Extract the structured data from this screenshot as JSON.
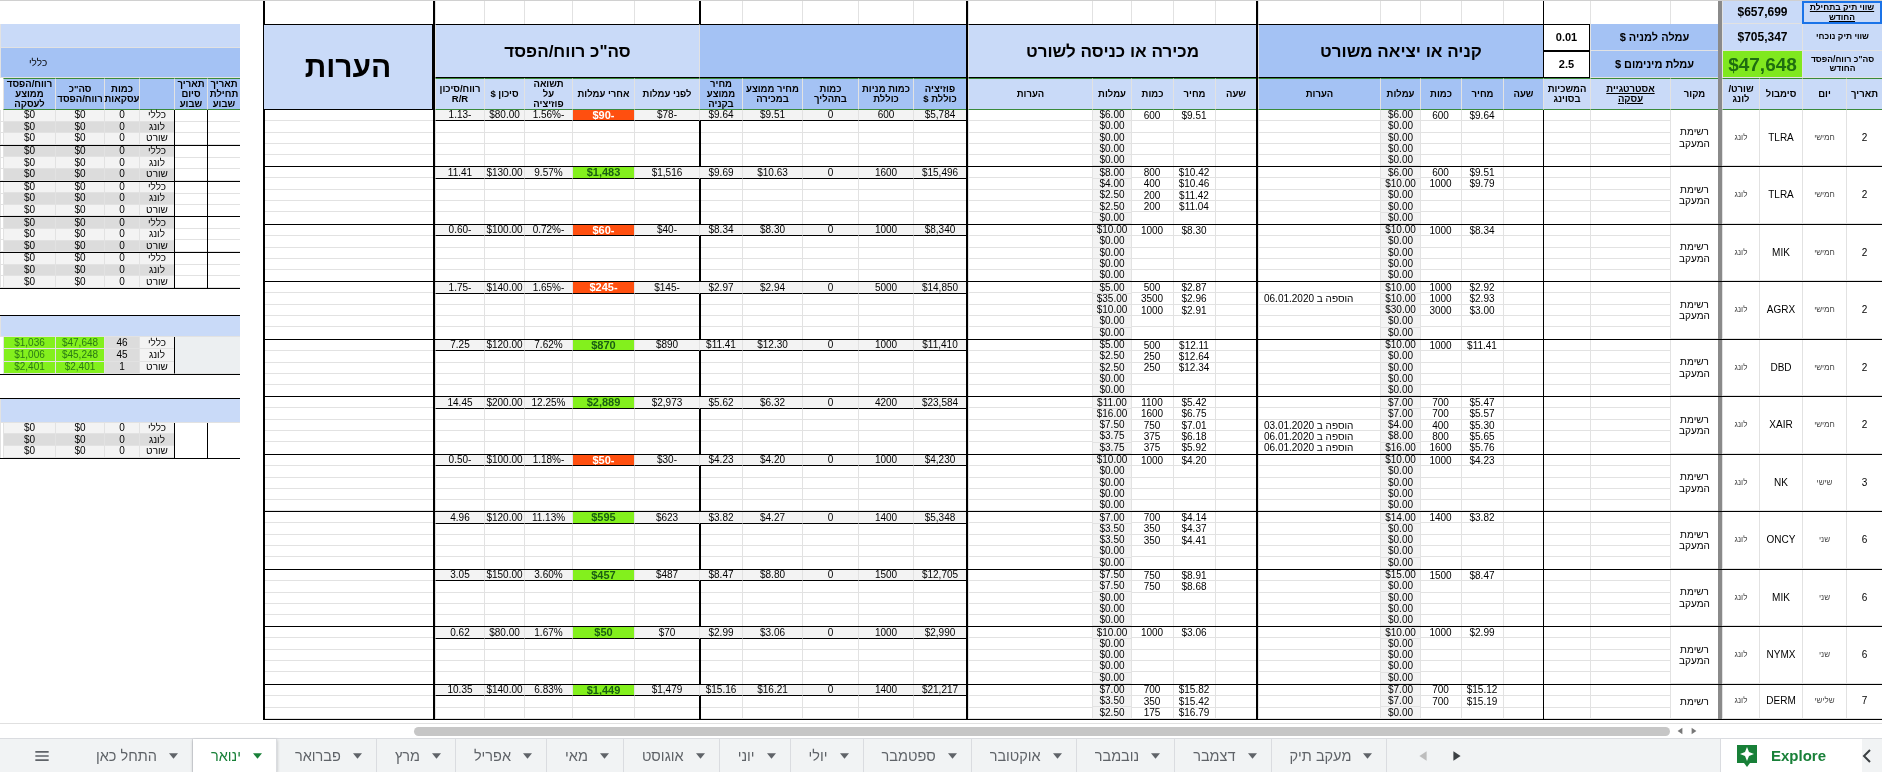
{
  "portfolio": [
    {
      "label": "שווי תיק בתחילת החודש",
      "value": "$657,699",
      "kind": "plain",
      "selected": true
    },
    {
      "label": "שווי תיק נוכחי",
      "value": "$705,347",
      "kind": "plain",
      "selected": false
    },
    {
      "label": "סה\"כ רווח/הפסד החודש",
      "value": "$47,648",
      "kind": "highlight",
      "selected": false
    }
  ],
  "fees": [
    {
      "label": "עמלה למניה $",
      "value": "0.01"
    },
    {
      "label": "עמלת מינימום $",
      "value": "2.5"
    }
  ],
  "sections": {
    "buy_title": "קניה או יציאה משורט",
    "sell_title": "מכירה או כניסה לשורט",
    "pl_title": "סה\"כ רווח/הפסד",
    "notes_title": "הערות"
  },
  "columns": {
    "frozen": [
      "תאריך",
      "יום",
      "סימבול",
      "שורט/ לונג"
    ],
    "pre": [
      "מקור",
      "אסטרטגיית עסקה",
      "המשכיות בסוינג"
    ],
    "buy": [
      "שעה",
      "מחיר",
      "כמות",
      "עמלות",
      "הערות"
    ],
    "sell": [
      "שעה",
      "מחיר",
      "כמות",
      "עמלות",
      "הערות"
    ],
    "position": [
      "פוזיציה כוללת $",
      "כמות מניות כוללת",
      "כמות בתהליך",
      "מחיר ממוצע במכירה",
      "מחיר ממוצע בקניה"
    ],
    "pl": [
      "לפני עמלות",
      "אחרי עמלות",
      "תשואה על פוזיציה",
      "סיכון $",
      "רווח/סיכון R/R"
    ]
  },
  "trades": [
    {
      "date": "2",
      "day": "חמישי",
      "symbol": "TLRA",
      "side": "לונג",
      "source": "רשימת המעקב",
      "buys": [
        {
          "fee": "$6.00",
          "qty": "600",
          "price": "$9.64"
        },
        {
          "fee": "$0.00"
        },
        {
          "fee": "$0.00"
        },
        {
          "fee": "$0.00"
        },
        {
          "fee": "$0.00"
        }
      ],
      "sells": [
        {
          "fee": "$6.00",
          "qty": "600",
          "price": "$9.51"
        },
        {
          "fee": "$0.00"
        },
        {
          "fee": "$0.00"
        },
        {
          "fee": "$0.00"
        },
        {
          "fee": "$0.00"
        }
      ],
      "position": {
        "total": "$5,784",
        "shares": "600",
        "in_progress": "0",
        "avg_sell": "$9.51",
        "avg_buy": "$9.64"
      },
      "pl": {
        "before": "$78-",
        "after": "$90-",
        "color": "#ff4f0f",
        "return": "1.56%-",
        "risk": "$80.00",
        "rr": "1.13-"
      }
    },
    {
      "date": "2",
      "day": "חמישי",
      "symbol": "TLRA",
      "side": "לונג",
      "source": "רשימת המעקב",
      "buys": [
        {
          "fee": "$6.00",
          "qty": "600",
          "price": "$9.51"
        },
        {
          "fee": "$10.00",
          "qty": "1000",
          "price": "$9.79"
        },
        {
          "fee": "$0.00"
        },
        {
          "fee": "$0.00"
        },
        {
          "fee": "$0.00"
        }
      ],
      "sells": [
        {
          "fee": "$8.00",
          "qty": "800",
          "price": "$10.42"
        },
        {
          "fee": "$4.00",
          "qty": "400",
          "price": "$10.46"
        },
        {
          "fee": "$2.50",
          "qty": "200",
          "price": "$11.42"
        },
        {
          "fee": "$2.50",
          "qty": "200",
          "price": "$11.04"
        },
        {
          "fee": "$0.00"
        }
      ],
      "position": {
        "total": "$15,496",
        "shares": "1600",
        "in_progress": "0",
        "avg_sell": "$10.63",
        "avg_buy": "$9.69"
      },
      "pl": {
        "before": "$1,516",
        "after": "$1,483",
        "color": "#83f01d",
        "return": "9.57%",
        "risk": "$130.00",
        "rr": "11.41"
      }
    },
    {
      "date": "2",
      "day": "חמישי",
      "symbol": "MIK",
      "side": "לונג",
      "source": "רשימת המעקב",
      "buys": [
        {
          "fee": "$10.00",
          "qty": "1000",
          "price": "$8.34"
        },
        {
          "fee": "$0.00"
        },
        {
          "fee": "$0.00"
        },
        {
          "fee": "$0.00"
        },
        {
          "fee": "$0.00"
        }
      ],
      "sells": [
        {
          "fee": "$10.00",
          "qty": "1000",
          "price": "$8.30"
        },
        {
          "fee": "$0.00"
        },
        {
          "fee": "$0.00"
        },
        {
          "fee": "$0.00"
        },
        {
          "fee": "$0.00"
        }
      ],
      "position": {
        "total": "$8,340",
        "shares": "1000",
        "in_progress": "0",
        "avg_sell": "$8.30",
        "avg_buy": "$8.34"
      },
      "pl": {
        "before": "$40-",
        "after": "$60-",
        "color": "#ff4f0f",
        "return": "0.72%-",
        "risk": "$100.00",
        "rr": "0.60-"
      }
    },
    {
      "date": "2",
      "day": "חמישי",
      "symbol": "AGRX",
      "side": "לונג",
      "source": "רשימת המעקב",
      "buys": [
        {
          "fee": "$10.00",
          "qty": "1000",
          "price": "$2.92"
        },
        {
          "fee": "$10.00",
          "qty": "1000",
          "price": "$2.93",
          "note": "הוספה ב 06.01.2020"
        },
        {
          "fee": "$30.00",
          "qty": "3000",
          "price": "$3.00"
        },
        {
          "fee": "$0.00"
        },
        {
          "fee": "$0.00"
        }
      ],
      "sells": [
        {
          "fee": "$5.00",
          "qty": "500",
          "price": "$2.87"
        },
        {
          "fee": "$35.00",
          "qty": "3500",
          "price": "$2.96"
        },
        {
          "fee": "$10.00",
          "qty": "1000",
          "price": "$2.91"
        },
        {
          "fee": "$0.00"
        },
        {
          "fee": "$0.00"
        }
      ],
      "position": {
        "total": "$14,850",
        "shares": "5000",
        "in_progress": "0",
        "avg_sell": "$2.94",
        "avg_buy": "$2.97"
      },
      "pl": {
        "before": "$145-",
        "after": "$245-",
        "color": "#ff4f0f",
        "return": "1.65%-",
        "risk": "$140.00",
        "rr": "1.75-"
      }
    },
    {
      "date": "2",
      "day": "חמישי",
      "symbol": "DBD",
      "side": "לונג",
      "source": "רשימת המעקב",
      "buys": [
        {
          "fee": "$10.00",
          "qty": "1000",
          "price": "$11.41"
        },
        {
          "fee": "$0.00"
        },
        {
          "fee": "$0.00"
        },
        {
          "fee": "$0.00"
        },
        {
          "fee": "$0.00"
        }
      ],
      "sells": [
        {
          "fee": "$5.00",
          "qty": "500",
          "price": "$12.11"
        },
        {
          "fee": "$2.50",
          "qty": "250",
          "price": "$12.64"
        },
        {
          "fee": "$2.50",
          "qty": "250",
          "price": "$12.34"
        },
        {
          "fee": "$0.00"
        },
        {
          "fee": "$0.00"
        }
      ],
      "position": {
        "total": "$11,410",
        "shares": "1000",
        "in_progress": "0",
        "avg_sell": "$12.30",
        "avg_buy": "$11.41"
      },
      "pl": {
        "before": "$890",
        "after": "$870",
        "color": "#83f01d",
        "return": "7.62%",
        "risk": "$120.00",
        "rr": "7.25"
      }
    },
    {
      "date": "2",
      "day": "חמישי",
      "symbol": "XAIR",
      "side": "לונג",
      "source": "רשימת המעקב",
      "buys": [
        {
          "fee": "$7.00",
          "qty": "700",
          "price": "$5.47"
        },
        {
          "fee": "$7.00",
          "qty": "700",
          "price": "$5.57"
        },
        {
          "fee": "$4.00",
          "qty": "400",
          "price": "$5.30",
          "note": "הוספה ב 03.01.2020"
        },
        {
          "fee": "$8.00",
          "qty": "800",
          "price": "$5.65",
          "note": "הוספה ב 06.01.2020"
        },
        {
          "fee": "$16.00",
          "qty": "1600",
          "price": "$5.76",
          "note": "הוספה ב 06.01.2020"
        }
      ],
      "sells": [
        {
          "fee": "$11.00",
          "qty": "1100",
          "price": "$5.42"
        },
        {
          "fee": "$16.00",
          "qty": "1600",
          "price": "$6.75"
        },
        {
          "fee": "$7.50",
          "qty": "750",
          "price": "$7.01"
        },
        {
          "fee": "$3.75",
          "qty": "375",
          "price": "$6.18"
        },
        {
          "fee": "$3.75",
          "qty": "375",
          "price": "$5.92"
        }
      ],
      "position": {
        "total": "$23,584",
        "shares": "4200",
        "in_progress": "0",
        "avg_sell": "$6.32",
        "avg_buy": "$5.62"
      },
      "pl": {
        "before": "$2,973",
        "after": "$2,889",
        "color": "#83f01d",
        "return": "12.25%",
        "risk": "$200.00",
        "rr": "14.45"
      }
    },
    {
      "date": "3",
      "day": "שישי",
      "symbol": "NK",
      "side": "לונג",
      "source": "רשימת המעקב",
      "buys": [
        {
          "fee": "$10.00",
          "qty": "1000",
          "price": "$4.23"
        },
        {
          "fee": "$0.00"
        },
        {
          "fee": "$0.00"
        },
        {
          "fee": "$0.00"
        },
        {
          "fee": "$0.00"
        }
      ],
      "sells": [
        {
          "fee": "$10.00",
          "qty": "1000",
          "price": "$4.20"
        },
        {
          "fee": "$0.00"
        },
        {
          "fee": "$0.00"
        },
        {
          "fee": "$0.00"
        },
        {
          "fee": "$0.00"
        }
      ],
      "position": {
        "total": "$4,230",
        "shares": "1000",
        "in_progress": "0",
        "avg_sell": "$4.20",
        "avg_buy": "$4.23"
      },
      "pl": {
        "before": "$30-",
        "after": "$50-",
        "color": "#ff4f0f",
        "return": "1.18%-",
        "risk": "$100.00",
        "rr": "0.50-"
      }
    },
    {
      "date": "6",
      "day": "שני",
      "symbol": "ONCY",
      "side": "לונג",
      "source": "רשימת המעקב",
      "buys": [
        {
          "fee": "$14.00",
          "qty": "1400",
          "price": "$3.82"
        },
        {
          "fee": "$0.00"
        },
        {
          "fee": "$0.00"
        },
        {
          "fee": "$0.00"
        },
        {
          "fee": "$0.00"
        }
      ],
      "sells": [
        {
          "fee": "$7.00",
          "qty": "700",
          "price": "$4.14"
        },
        {
          "fee": "$3.50",
          "qty": "350",
          "price": "$4.37"
        },
        {
          "fee": "$3.50",
          "qty": "350",
          "price": "$4.41"
        },
        {
          "fee": "$0.00"
        },
        {
          "fee": "$0.00"
        }
      ],
      "position": {
        "total": "$5,348",
        "shares": "1400",
        "in_progress": "0",
        "avg_sell": "$4.27",
        "avg_buy": "$3.82"
      },
      "pl": {
        "before": "$623",
        "after": "$595",
        "color": "#83f01d",
        "return": "11.13%",
        "risk": "$120.00",
        "rr": "4.96"
      }
    },
    {
      "date": "6",
      "day": "שני",
      "symbol": "MIK",
      "side": "לונג",
      "source": "רשימת המעקב",
      "buys": [
        {
          "fee": "$15.00",
          "qty": "1500",
          "price": "$8.47"
        },
        {
          "fee": "$0.00"
        },
        {
          "fee": "$0.00"
        },
        {
          "fee": "$0.00"
        },
        {
          "fee": "$0.00"
        }
      ],
      "sells": [
        {
          "fee": "$7.50",
          "qty": "750",
          "price": "$8.91"
        },
        {
          "fee": "$7.50",
          "qty": "750",
          "price": "$8.68"
        },
        {
          "fee": "$0.00"
        },
        {
          "fee": "$0.00"
        },
        {
          "fee": "$0.00"
        }
      ],
      "position": {
        "total": "$12,705",
        "shares": "1500",
        "in_progress": "0",
        "avg_sell": "$8.80",
        "avg_buy": "$8.47"
      },
      "pl": {
        "before": "$487",
        "after": "$457",
        "color": "#83f01d",
        "return": "3.60%",
        "risk": "$150.00",
        "rr": "3.05"
      }
    },
    {
      "date": "6",
      "day": "שני",
      "symbol": "NYMX",
      "side": "לונג",
      "source": "רשימת המעקב",
      "buys": [
        {
          "fee": "$10.00",
          "qty": "1000",
          "price": "$2.99"
        },
        {
          "fee": "$0.00"
        },
        {
          "fee": "$0.00"
        },
        {
          "fee": "$0.00"
        },
        {
          "fee": "$0.00"
        }
      ],
      "sells": [
        {
          "fee": "$10.00",
          "qty": "1000",
          "price": "$3.06"
        },
        {
          "fee": "$0.00"
        },
        {
          "fee": "$0.00"
        },
        {
          "fee": "$0.00"
        },
        {
          "fee": "$0.00"
        }
      ],
      "position": {
        "total": "$2,990",
        "shares": "1000",
        "in_progress": "0",
        "avg_sell": "$3.06",
        "avg_buy": "$2.99"
      },
      "pl": {
        "before": "$70",
        "after": "$50",
        "color": "#83f01d",
        "return": "1.67%",
        "risk": "$80.00",
        "rr": "0.62"
      }
    },
    {
      "date": "7",
      "day": "שלישי",
      "symbol": "DERM",
      "side": "לונג",
      "source": "רשימת",
      "buys": [
        {
          "fee": "$7.00",
          "qty": "700",
          "price": "$15.12"
        },
        {
          "fee": "$7.00",
          "qty": "700",
          "price": "$15.19"
        },
        {
          "fee": "$0.00"
        }
      ],
      "sells": [
        {
          "fee": "$7.00",
          "qty": "700",
          "price": "$15.82"
        },
        {
          "fee": "$3.50",
          "qty": "350",
          "price": "$15.42"
        },
        {
          "fee": "$2.50",
          "qty": "175",
          "price": "$16.79"
        }
      ],
      "position": {
        "total": "$21,217",
        "shares": "1400",
        "in_progress": "0",
        "avg_sell": "$16.21",
        "avg_buy": "$15.16"
      },
      "pl": {
        "before": "$1,479",
        "after": "$1,449",
        "color": "#83f01d",
        "return": "6.83%",
        "risk": "$140.00",
        "rr": "10.35"
      }
    }
  ],
  "weekly": {
    "band": "כללי",
    "headers": {
      "week_start": "תאריך תחילת שבוע",
      "week_end": "תאריך סיום שבוע",
      "count": "כמות עסקאות",
      "total": "סה\"כ רווח/הפסד",
      "avg": "רווח/הפסד ממוצע לעסקה"
    },
    "weeks": [
      {
        "rows": [
          {
            "label": "כללי",
            "count": "0",
            "total": "$0",
            "avg": "$0"
          },
          {
            "label": "לונג",
            "count": "0",
            "total": "$0",
            "avg": "$0"
          },
          {
            "label": "שורט",
            "count": "0",
            "total": "$0",
            "avg": "$0"
          }
        ]
      },
      {
        "rows": [
          {
            "label": "כללי",
            "count": "0",
            "total": "$0",
            "avg": "$0"
          },
          {
            "label": "לונג",
            "count": "0",
            "total": "$0",
            "avg": "$0"
          },
          {
            "label": "שורט",
            "count": "0",
            "total": "$0",
            "avg": "$0"
          }
        ]
      },
      {
        "rows": [
          {
            "label": "כללי",
            "count": "0",
            "total": "$0",
            "avg": "$0"
          },
          {
            "label": "לונג",
            "count": "0",
            "total": "$0",
            "avg": "$0"
          },
          {
            "label": "שורט",
            "count": "0",
            "total": "$0",
            "avg": "$0"
          }
        ]
      },
      {
        "rows": [
          {
            "label": "כללי",
            "count": "0",
            "total": "$0",
            "avg": "$0"
          },
          {
            "label": "לונג",
            "count": "0",
            "total": "$0",
            "avg": "$0"
          },
          {
            "label": "שורט",
            "count": "0",
            "total": "$0",
            "avg": "$0"
          }
        ]
      },
      {
        "rows": [
          {
            "label": "כללי",
            "count": "0",
            "total": "$0",
            "avg": "$0"
          },
          {
            "label": "לונג",
            "count": "0",
            "total": "$0",
            "avg": "$0"
          },
          {
            "label": "שורט",
            "count": "0",
            "total": "$0",
            "avg": "$0"
          }
        ]
      }
    ],
    "summary": [
      {
        "label": "כללי",
        "count": "46",
        "total": "$47,648",
        "avg": "$1,036"
      },
      {
        "label": "לונג",
        "count": "45",
        "total": "$45,248",
        "avg": "$1,006"
      },
      {
        "label": "שורט",
        "count": "1",
        "total": "$2,401",
        "avg": "$2,401"
      }
    ],
    "extra": [
      {
        "label": "כללי",
        "count": "0",
        "total": "$0",
        "avg": "$0"
      },
      {
        "label": "לונג",
        "count": "0",
        "total": "$0",
        "avg": "$0"
      },
      {
        "label": "שורט",
        "count": "0",
        "total": "$0",
        "avg": "$0"
      }
    ]
  },
  "tabs": [
    {
      "label": "מעקב תיק",
      "selected": false
    },
    {
      "label": "דצמבר",
      "selected": false
    },
    {
      "label": "נובמבר",
      "selected": false
    },
    {
      "label": "אוקטובר",
      "selected": false
    },
    {
      "label": "ספטמבר",
      "selected": false
    },
    {
      "label": "יולי",
      "selected": false
    },
    {
      "label": "יוני",
      "selected": false
    },
    {
      "label": "אוגוסט",
      "selected": false
    },
    {
      "label": "מאי",
      "selected": false
    },
    {
      "label": "אפריל",
      "selected": false
    },
    {
      "label": "מרץ",
      "selected": false
    },
    {
      "label": "פברואר",
      "selected": false
    },
    {
      "label": "ינואר",
      "selected": true
    },
    {
      "label": "התחל כאן",
      "selected": false
    }
  ],
  "explore": "Explore"
}
